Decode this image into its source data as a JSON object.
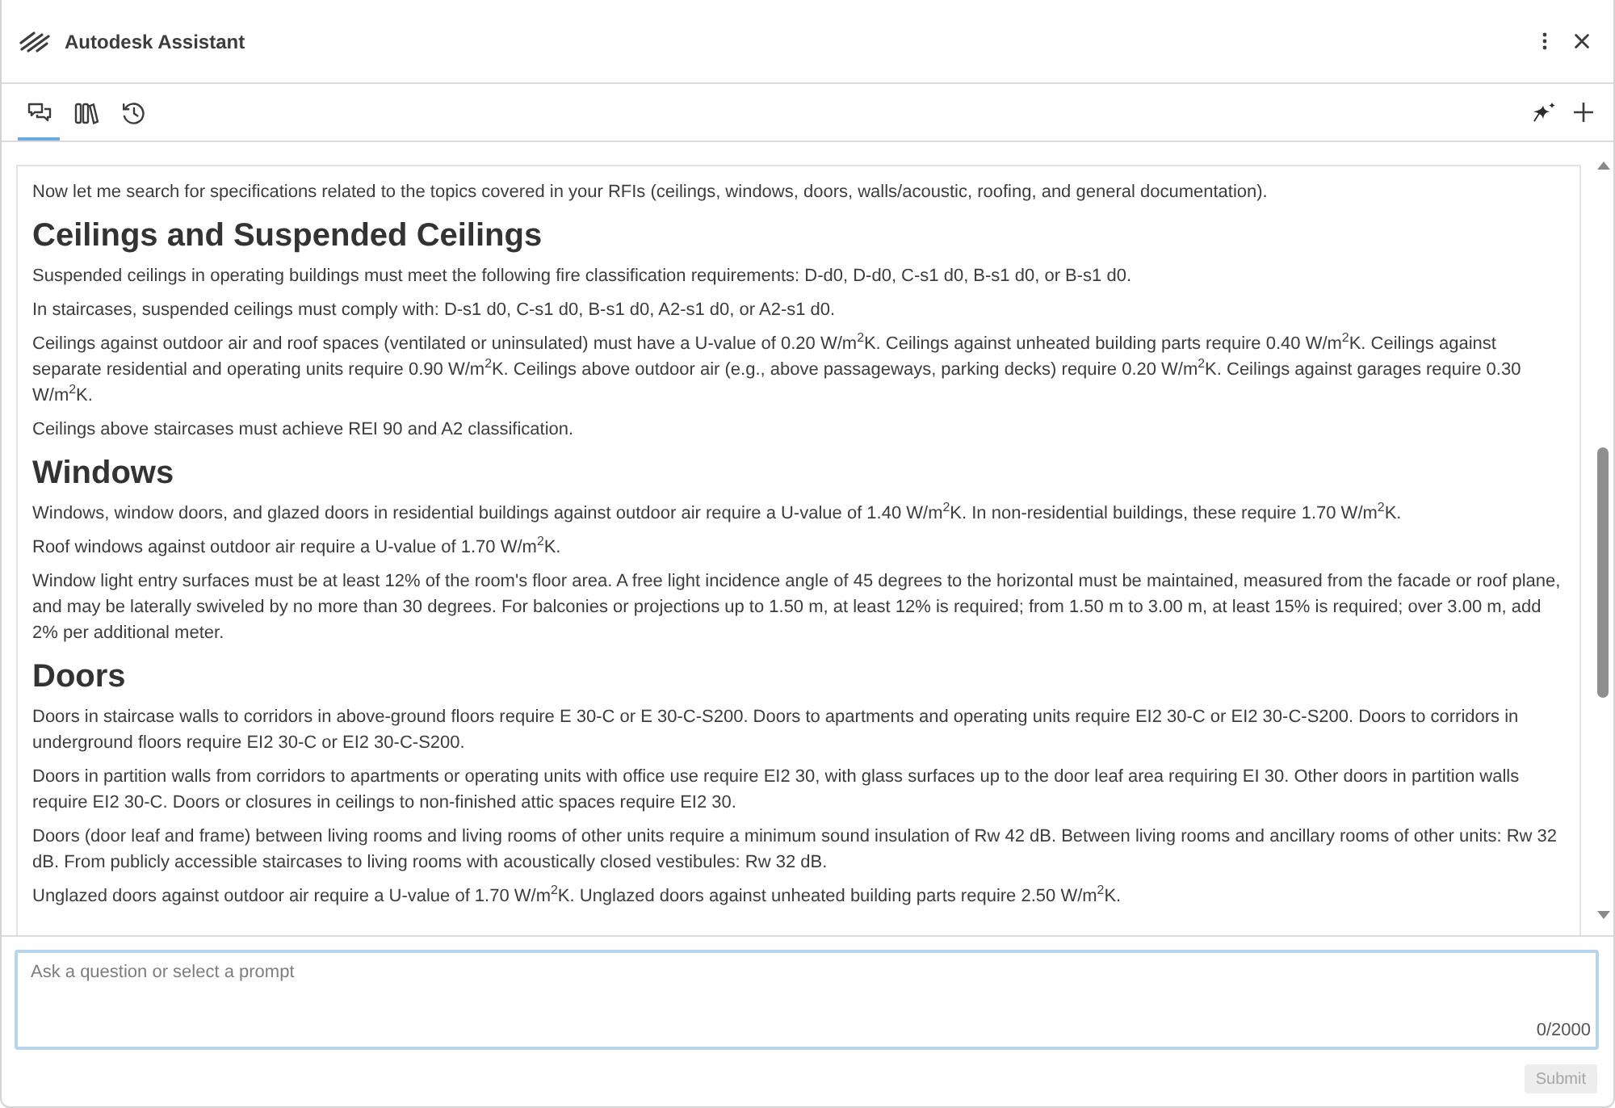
{
  "window": {
    "title": "Autodesk Assistant"
  },
  "tabs": [
    {
      "selected": true
    },
    {
      "selected": false
    },
    {
      "selected": false
    }
  ],
  "content": [
    {
      "kind": "paragraph",
      "text": "Now let me search for specifications related to the topics covered in your RFIs (ceilings, windows, doors, walls/acoustic, roofing, and general documentation)."
    },
    {
      "kind": "heading",
      "text": "Ceilings and Suspended Ceilings"
    },
    {
      "kind": "paragraph",
      "text": "Suspended ceilings in operating buildings must meet the following fire classification requirements: D-d0, D-d0, C-s1 d0, B-s1 d0, or B-s1 d0."
    },
    {
      "kind": "paragraph",
      "text": "In staircases, suspended ceilings must comply with: D-s1 d0, C-s1 d0, B-s1 d0, A2-s1 d0, or A2-s1 d0."
    },
    {
      "kind": "paragraph",
      "text": "Ceilings against outdoor air and roof spaces (ventilated or uninsulated) must have a U-value of 0.20 W/m$^{2}$K. Ceilings against unheated building parts require 0.40 W/m$^{2}$K. Ceilings against separate residential and operating units require 0.90 W/m$^{2}$K. Ceilings above outdoor air (e.g., above passageways, parking decks) require 0.20 W/m$^{2}$K. Ceilings against garages require 0.30 W/m$^{2}$K."
    },
    {
      "kind": "paragraph",
      "text": "Ceilings above staircases must achieve REI 90 and A2 classification."
    },
    {
      "kind": "heading",
      "text": "Windows"
    },
    {
      "kind": "paragraph",
      "text": "Windows, window doors, and glazed doors in residential buildings against outdoor air require a U-value of 1.40 W/m$^{2}$K. In non-residential buildings, these require 1.70 W/m$^{2}$K."
    },
    {
      "kind": "paragraph",
      "text": "Roof windows against outdoor air require a U-value of 1.70 W/m$^{2}$K."
    },
    {
      "kind": "paragraph",
      "text": "Window light entry surfaces must be at least 12% of the room's floor area. A free light incidence angle of 45 degrees to the horizontal must be maintained, measured from the facade or roof plane, and may be laterally swiveled by no more than 30 degrees. For balconies or projections up to 1.50 m, at least 12% is required; from 1.50 m to 3.00 m, at least 15% is required; over 3.00 m, add 2% per additional meter."
    },
    {
      "kind": "heading",
      "text": "Doors"
    },
    {
      "kind": "paragraph",
      "text": "Doors in staircase walls to corridors in above-ground floors require E 30-C or E 30-C-S200. Doors to apartments and operating units require EI2 30-C or EI2 30-C-S200. Doors to corridors in underground floors require EI2 30-C or EI2 30-C-S200."
    },
    {
      "kind": "paragraph",
      "text": "Doors in partition walls from corridors to apartments or operating units with office use require EI2 30, with glass surfaces up to the door leaf area requiring EI 30. Other doors in partition walls require EI2 30-C. Doors or closures in ceilings to non-finished attic spaces require EI2 30."
    },
    {
      "kind": "paragraph",
      "text": "Doors (door leaf and frame) between living rooms and living rooms of other units require a minimum sound insulation of Rw 42 dB. Between living rooms and ancillary rooms of other units: Rw 32 dB. From publicly accessible staircases to living rooms with acoustically closed vestibules: Rw 32 dB."
    },
    {
      "kind": "paragraph",
      "text": "Unglazed doors against outdoor air require a U-value of 1.70 W/m$^{2}$K. Unglazed doors against unheated building parts require 2.50 W/m$^{2}$K."
    }
  ],
  "composer": {
    "placeholder": "Ask a question or select a prompt",
    "counter": "0/2000"
  },
  "submit": {
    "label": "Submit",
    "disabled": true
  }
}
